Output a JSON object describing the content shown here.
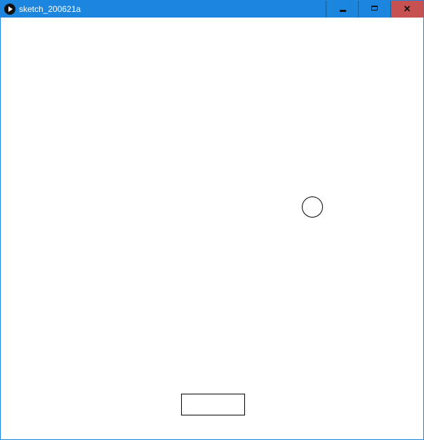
{
  "window": {
    "title": "sketch_200621a",
    "app_icon": "processing-play-icon",
    "controls": {
      "minimize": "minimize-icon",
      "maximize": "maximize-icon",
      "close": "close-icon",
      "close_glyph": "✕"
    },
    "colors": {
      "titlebar": "#1c86de",
      "close_button": "#c75050",
      "canvas": "#ffffff",
      "shape_stroke": "#000000"
    }
  },
  "canvas": {
    "objects": [
      {
        "kind": "circle",
        "name": "ball"
      },
      {
        "kind": "rectangle",
        "name": "paddle"
      }
    ]
  }
}
